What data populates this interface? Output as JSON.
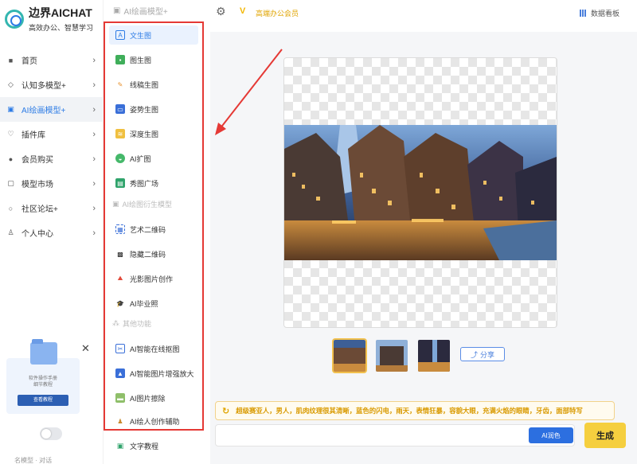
{
  "brand": {
    "title": "边界AICHAT",
    "subtitle": "高效办公、智慧学习"
  },
  "nav": {
    "items": [
      {
        "label": "首页",
        "icon": "home-icon"
      },
      {
        "label": "认知多模型+",
        "icon": "cube-icon"
      },
      {
        "label": "AI绘画模型+",
        "icon": "paint-icon",
        "active": true
      },
      {
        "label": "插件库",
        "icon": "plugin-icon"
      },
      {
        "label": "会员购买",
        "icon": "user-icon"
      },
      {
        "label": "模型市场",
        "icon": "store-icon"
      },
      {
        "label": "社区论坛+",
        "icon": "chat-icon"
      },
      {
        "label": "个人中心",
        "icon": "person-icon"
      }
    ],
    "promo": {
      "text1": "软件操作手册",
      "text2": "细节教程",
      "button": "查看教程"
    },
    "bottom": "名模型 · 对话"
  },
  "submenu": {
    "header": "AI绘画模型+",
    "items": [
      {
        "label": "文生图",
        "active": true
      },
      {
        "label": "图生图"
      },
      {
        "label": "线稿生图"
      },
      {
        "label": "姿势生图"
      },
      {
        "label": "深度生图"
      },
      {
        "label": "AI扩图"
      },
      {
        "label": "秀图广场"
      }
    ],
    "section2": "AI绘图衍生模型",
    "items2": [
      {
        "label": "艺术二维码"
      },
      {
        "label": "隐藏二维码"
      },
      {
        "label": "光影图片创作"
      },
      {
        "label": "AI毕业照"
      }
    ],
    "section3": "其他功能",
    "items3": [
      {
        "label": "AI智能在线抠图"
      },
      {
        "label": "AI智能图片增强放大"
      },
      {
        "label": "AI图片擦除"
      },
      {
        "label": "AI绘人创作辅助"
      }
    ],
    "bottom_item": "文字教程"
  },
  "topbar": {
    "vip": "高端办公会员",
    "dashboard": "数据看板"
  },
  "workspace": {
    "share": "分享",
    "prompt": "超级赛亚人，男人，肌肉纹理很其清晰，蓝色的闪电，雨天，表情狂暴，容貌大眼，充满火焰的眼睛，牙齿，面部特写",
    "ai_button": "AI润色",
    "generate": "生成"
  },
  "colors": {
    "accent": "#2c7be5",
    "highlight_box": "#e53935",
    "generate": "#f5cf3f",
    "prompt_text": "#d99a00"
  }
}
